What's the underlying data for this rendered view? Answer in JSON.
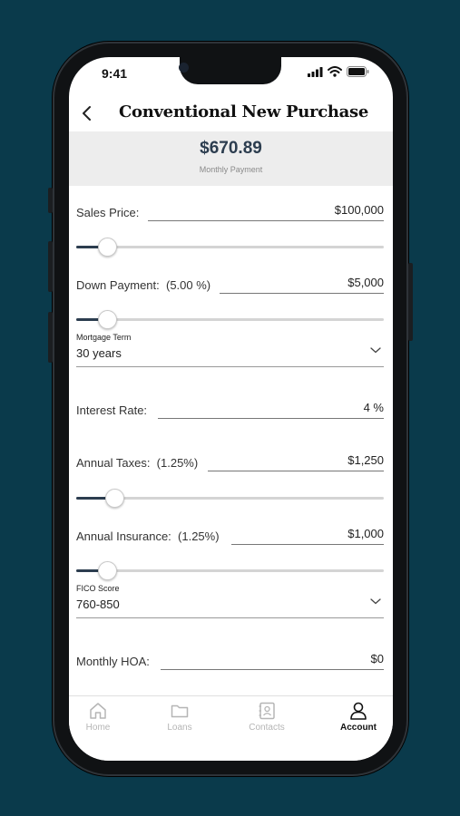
{
  "status": {
    "time": "9:41"
  },
  "nav": {
    "title": "Conventional New Purchase"
  },
  "summary": {
    "amount": "$670.89",
    "label": "Monthly Payment"
  },
  "fields": {
    "sales_price": {
      "label": "Sales Price:",
      "value": "$100,000",
      "slider_level": 0.1
    },
    "down_payment": {
      "label": "Down Payment:",
      "percent": "(5.00 %)",
      "value": "$5,000",
      "slider_level": 0.1
    },
    "mortgage_term": {
      "caption": "Mortgage Term",
      "value": "30 years"
    },
    "interest_rate": {
      "label": "Interest Rate:",
      "value": "4 %"
    },
    "annual_taxes": {
      "label": "Annual Taxes:",
      "percent": "(1.25%)",
      "value": "$1,250",
      "slider_level": 0.125
    },
    "annual_insurance": {
      "label": "Annual Insurance:",
      "percent": "(1.25%)",
      "value": "$1,000",
      "slider_level": 0.1
    },
    "fico_score": {
      "caption": "FICO Score",
      "value": "760-850"
    },
    "monthly_hoa": {
      "label": "Monthly HOA:",
      "value": "$0"
    }
  },
  "tabs": [
    {
      "label": "Home",
      "icon": "home-icon",
      "active": false
    },
    {
      "label": "Loans",
      "icon": "folder-icon",
      "active": false
    },
    {
      "label": "Contacts",
      "icon": "contacts-icon",
      "active": false
    },
    {
      "label": "Account",
      "icon": "user-icon",
      "active": true
    }
  ],
  "colors": {
    "background": "#0a3a4b",
    "accent": "#2c3d4f"
  }
}
